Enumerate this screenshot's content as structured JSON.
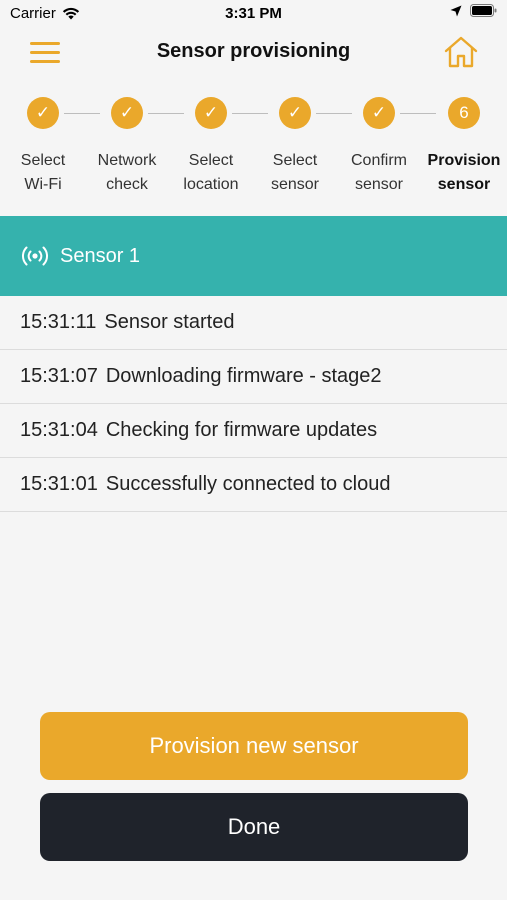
{
  "status_bar": {
    "carrier": "Carrier",
    "time": "3:31 PM"
  },
  "header": {
    "title": "Sensor provisioning",
    "accent_color": "#eaa82b"
  },
  "stepper": {
    "steps": [
      {
        "label": "Select\nWi-Fi",
        "state": "done",
        "mark": "✓"
      },
      {
        "label": "Network\ncheck",
        "state": "done",
        "mark": "✓"
      },
      {
        "label": "Select\nlocation",
        "state": "done",
        "mark": "✓"
      },
      {
        "label": "Select\nsensor",
        "state": "done",
        "mark": "✓"
      },
      {
        "label": "Confirm\nsensor",
        "state": "done",
        "mark": "✓"
      },
      {
        "label": "Provision\nsensor",
        "state": "active",
        "mark": "6"
      }
    ]
  },
  "sensor": {
    "name": "Sensor 1",
    "band_color": "#35b2ad"
  },
  "log": [
    {
      "time": "15:31:11",
      "message": "Sensor started"
    },
    {
      "time": "15:31:07",
      "message": "Downloading firmware - stage2"
    },
    {
      "time": "15:31:04",
      "message": "Checking for firmware updates"
    },
    {
      "time": "15:31:01",
      "message": "Successfully connected to cloud"
    }
  ],
  "actions": {
    "provision_label": "Provision new sensor",
    "done_label": "Done"
  }
}
